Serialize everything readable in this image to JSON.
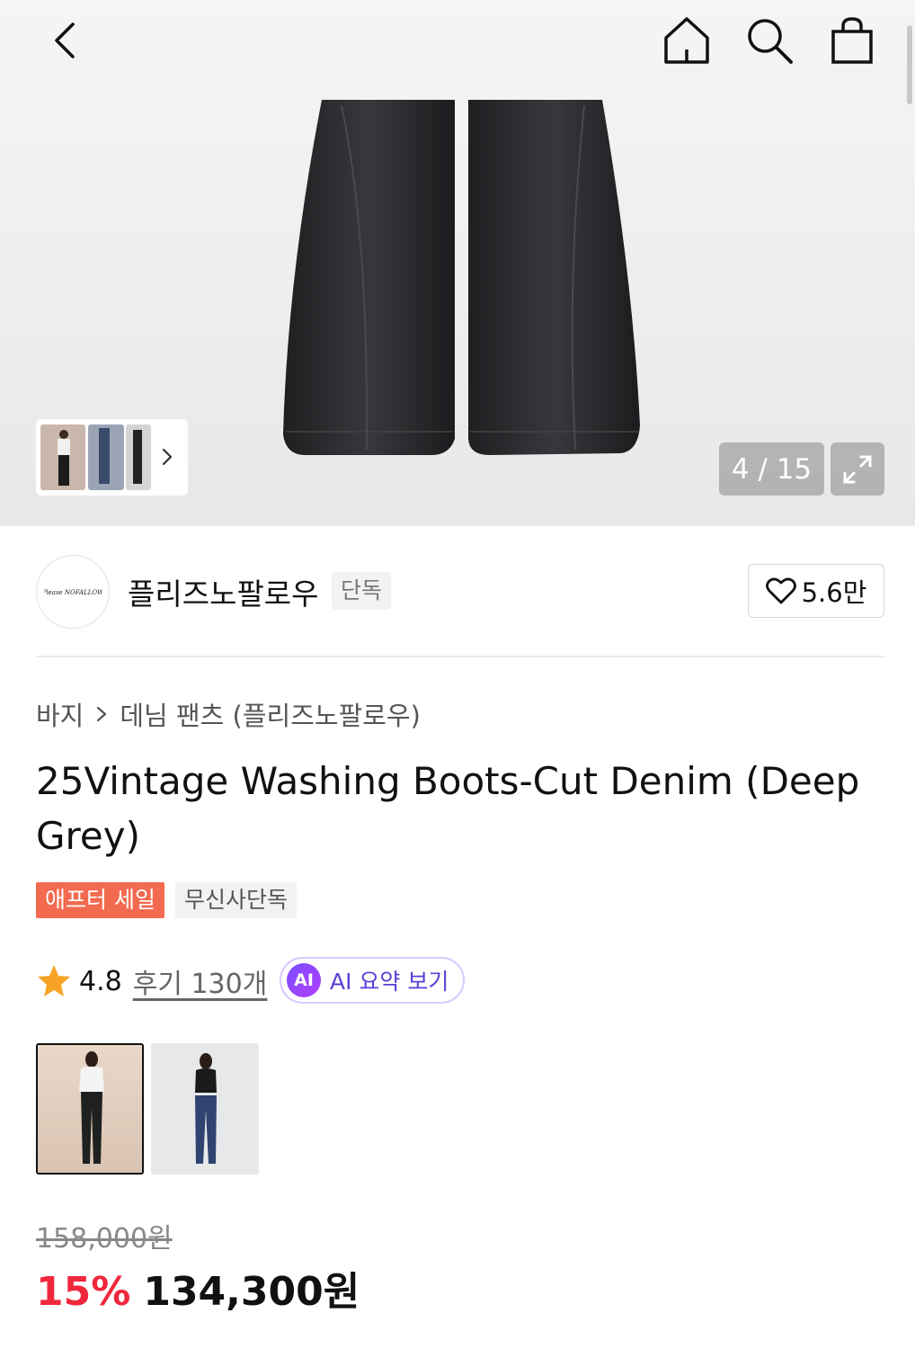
{
  "hero": {
    "image_counter": "4 / 15"
  },
  "brand": {
    "logo_text": "Please NOFALLOW",
    "name": "플리즈노팔로우",
    "tag": "단독",
    "likes": "5.6만"
  },
  "breadcrumb": {
    "items": [
      "바지",
      "데님 팬츠 (플리즈노팔로우)"
    ]
  },
  "product": {
    "title": "25Vintage Washing Boots-Cut Denim (Deep Grey)",
    "badges": [
      "애프터 세일",
      "무신사단독"
    ],
    "rating": "4.8",
    "reviews": "후기 130개",
    "ai_badge": "AI",
    "ai_summary": "AI 요약 보기"
  },
  "price": {
    "original": "158,000원",
    "discount": "15%",
    "final": "134,300원"
  },
  "colors": {
    "accent_red": "#f0283c",
    "sale_badge": "#f26a4f",
    "ai_purple": "#7b4dff",
    "star": "#f7a325"
  }
}
